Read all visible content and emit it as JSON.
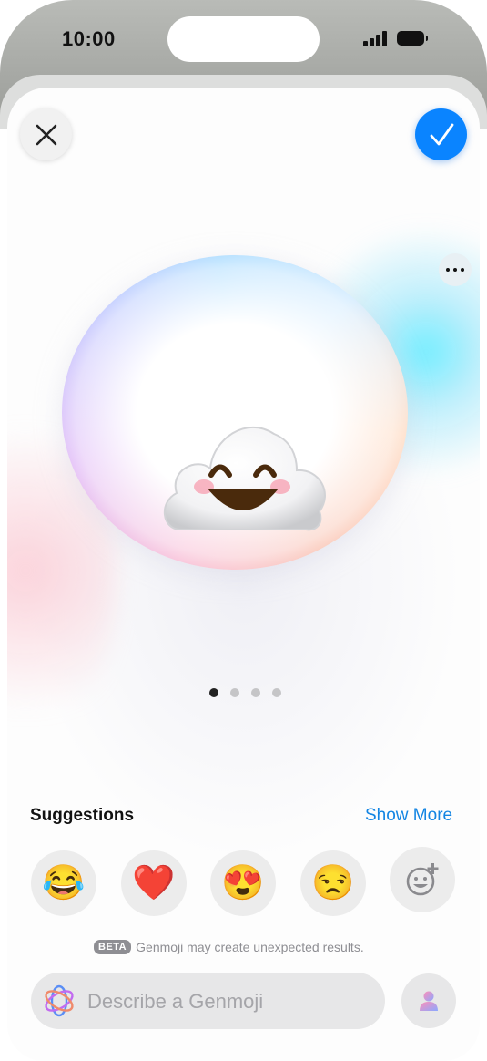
{
  "status_bar": {
    "time": "10:00"
  },
  "colors": {
    "accent": "#0a84ff",
    "link": "#1385e3"
  },
  "toolbar": {
    "close_icon": "xmark-icon",
    "confirm_icon": "checkmark-icon",
    "more_icon": "ellipsis-icon"
  },
  "preview": {
    "emoji": "smiling-cloud-genmoji",
    "page_count": 4,
    "current_page": 1
  },
  "suggestions": {
    "title": "Suggestions",
    "show_more_label": "Show More",
    "items": [
      "😂",
      "❤️",
      "😍",
      "😒"
    ],
    "add_icon": "emoji-add-icon"
  },
  "disclaimer": {
    "badge": "BETA",
    "text": "Genmoji may create unexpected results."
  },
  "composer": {
    "placeholder": "Describe a Genmoji",
    "value": ""
  }
}
